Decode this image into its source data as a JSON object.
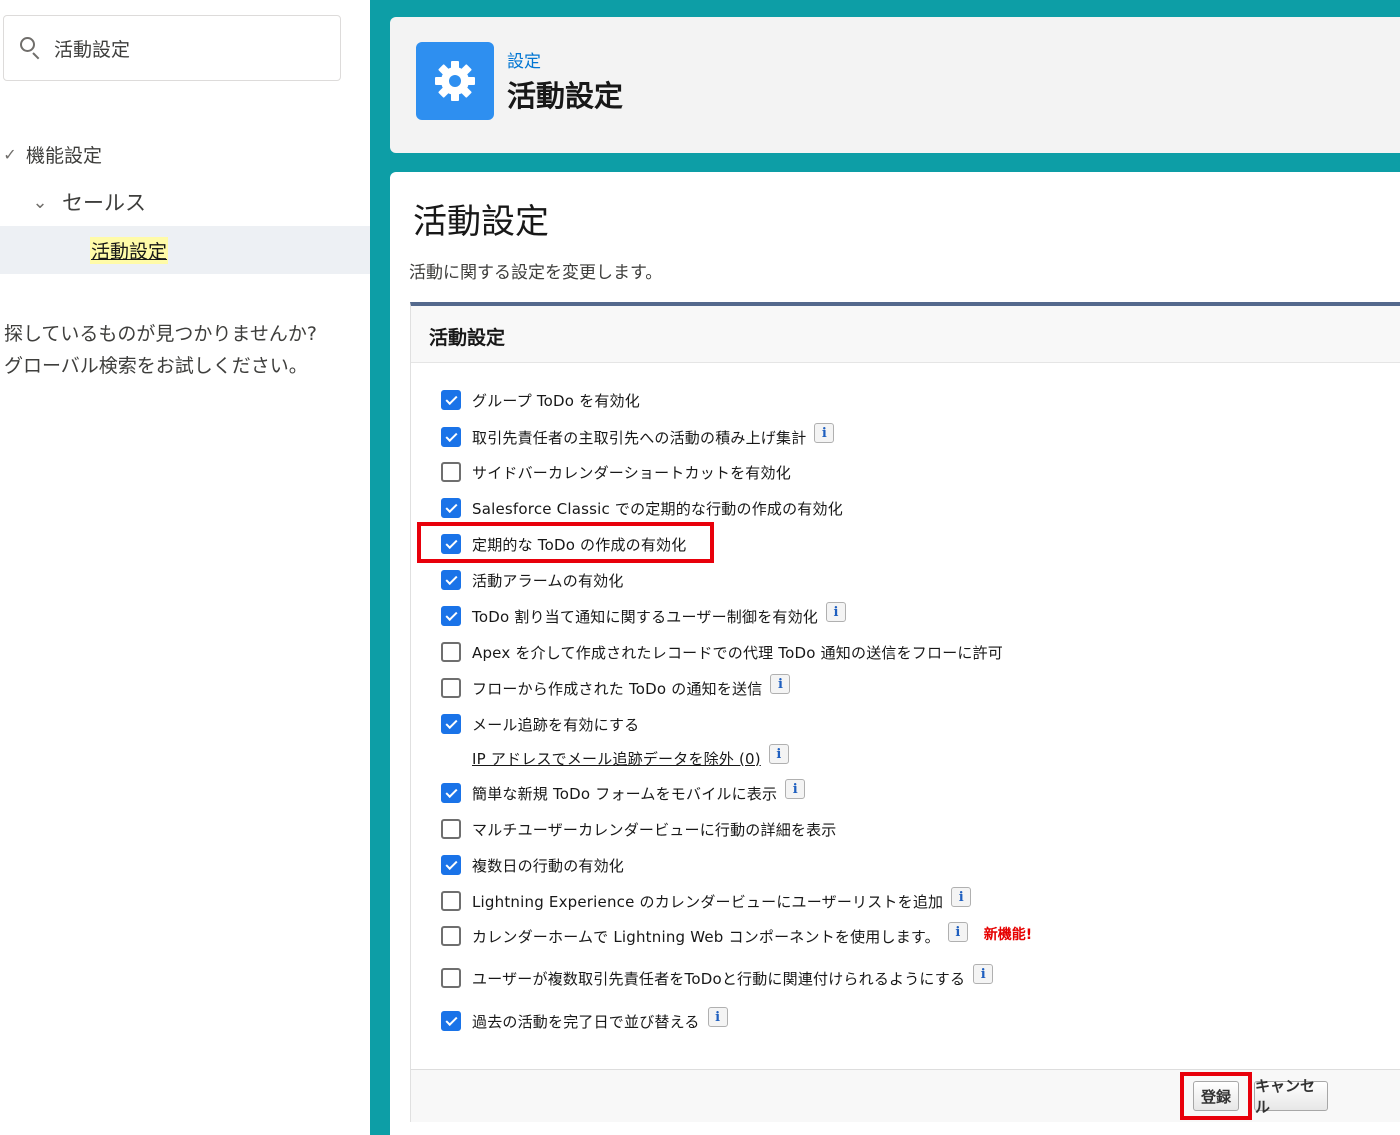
{
  "sidebar": {
    "search_value": "活動設定",
    "tree": {
      "root_label": "機能設定",
      "sales_label": "セールス",
      "selected_label": "活動設定"
    },
    "help_line1": "探しているものが見つかりませんか?",
    "help_line2": "グローバル検索をお試しください。"
  },
  "header": {
    "breadcrumb": "設定",
    "title": "活動設定",
    "icon": "gear-icon"
  },
  "content": {
    "title": "活動設定",
    "description": "活動に関する設定を変更します。"
  },
  "panel": {
    "title": "活動設定",
    "options": [
      {
        "label": "グループ ToDo を有効化",
        "checked": true,
        "info": false
      },
      {
        "label": "取引先責任者の主取引先への活動の積み上げ集計",
        "checked": true,
        "info": true
      },
      {
        "label": "サイドバーカレンダーショートカットを有効化",
        "checked": false,
        "info": false
      },
      {
        "label": "Salesforce Classic での定期的な行動の作成の有効化",
        "checked": true,
        "info": false
      },
      {
        "label": "定期的な ToDo の作成の有効化",
        "checked": true,
        "info": false
      },
      {
        "label": "活動アラームの有効化",
        "checked": true,
        "info": false
      },
      {
        "label": "ToDo 割り当て通知に関するユーザー制御を有効化",
        "checked": true,
        "info": true
      },
      {
        "label": "Apex を介して作成されたレコードでの代理 ToDo 通知の送信をフローに許可",
        "checked": false,
        "info": false
      },
      {
        "label": "フローから作成された ToDo の通知を送信",
        "checked": false,
        "info": true
      },
      {
        "label": "メール追跡を有効にする",
        "checked": true,
        "info": false
      },
      {
        "label": "IP アドレスでメール追跡データを除外 (0)",
        "checked": null,
        "info": true
      },
      {
        "label": "簡単な新規 ToDo フォームをモバイルに表示",
        "checked": true,
        "info": true
      },
      {
        "label": "マルチユーザーカレンダービューに行動の詳細を表示",
        "checked": false,
        "info": false
      },
      {
        "label": "複数日の行動の有効化",
        "checked": true,
        "info": false
      },
      {
        "label": "Lightning Experience のカレンダービューにユーザーリストを追加",
        "checked": false,
        "info": true
      },
      {
        "label": "カレンダーホームで Lightning Web コンポーネントを使用します。",
        "checked": false,
        "info": true,
        "badge": "新機能!"
      },
      {
        "label": "ユーザーが複数取引先責任者をToDoと行動に関連付けられるようにする",
        "checked": false,
        "info": true
      },
      {
        "label": "過去の活動を完了日で並び替える",
        "checked": true,
        "info": true
      }
    ],
    "info_glyph": "i"
  },
  "footer": {
    "save_label": "登録",
    "cancel_label": "キャンセル"
  },
  "colors": {
    "teal_background": "#0d9ea6",
    "checkbox_blue": "#1a73e8",
    "highlight_red": "#e8000b",
    "header_icon_blue": "#2e8ff0"
  }
}
